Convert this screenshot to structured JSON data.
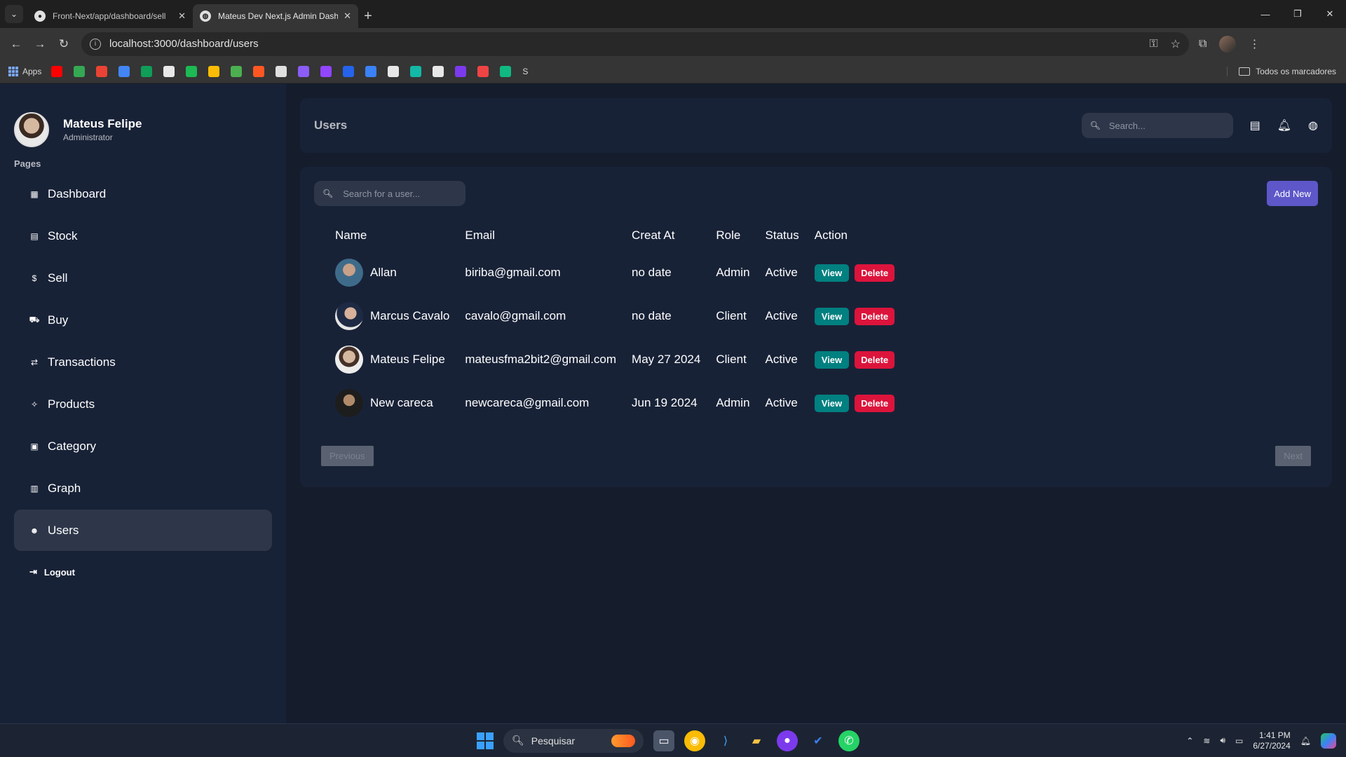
{
  "browser": {
    "tabs": [
      {
        "title": "Front-Next/app/dashboard/sell",
        "active": false,
        "icon": "github-icon"
      },
      {
        "title": "Mateus Dev Next.js Admin Dashboard",
        "active": true,
        "icon": "globe-icon"
      }
    ],
    "url": "localhost:3000/dashboard/users",
    "bookmarks_apps_label": "Apps",
    "bookmarks_s_label": "S",
    "all_bookmarks_label": "Todos os marcadores",
    "bookmark_colors": [
      "#ff0000",
      "#34a853",
      "#ea4335",
      "#4285f4",
      "#0f9d58",
      "#e8e8e8",
      "#1db954",
      "#fbbc05",
      "#4caf50",
      "#ff5722",
      "#e0e0e0",
      "#8b5cf6",
      "#9146ff",
      "#2563eb",
      "#3b82f6",
      "#e8e8e8",
      "#14b8a6",
      "#e8e8e8",
      "#7c3aed",
      "#ef4444",
      "#10b981"
    ]
  },
  "sidebar": {
    "user_name": "Mateus Felipe",
    "user_role": "Administrator",
    "section_title": "Pages",
    "items": [
      {
        "label": "Dashboard",
        "icon": "dashboard-icon",
        "glyph": "▦",
        "active": false
      },
      {
        "label": "Stock",
        "icon": "stock-icon",
        "glyph": "▤",
        "active": false
      },
      {
        "label": "Sell",
        "icon": "dollar-icon",
        "glyph": "$",
        "active": false
      },
      {
        "label": "Buy",
        "icon": "cart-icon",
        "glyph": "⛟",
        "active": false
      },
      {
        "label": "Transactions",
        "icon": "transactions-icon",
        "glyph": "⇄",
        "active": false
      },
      {
        "label": "Products",
        "icon": "products-icon",
        "glyph": "✧",
        "active": false
      },
      {
        "label": "Category",
        "icon": "category-icon",
        "glyph": "▣",
        "active": false
      },
      {
        "label": "Graph",
        "icon": "graph-icon",
        "glyph": "▥",
        "active": false
      },
      {
        "label": "Users",
        "icon": "users-icon",
        "glyph": "☻",
        "active": true
      }
    ],
    "logout_label": "Logout"
  },
  "topbar": {
    "title": "Users",
    "search_placeholder": "Search..."
  },
  "users_panel": {
    "search_placeholder": "Search for a user...",
    "add_new_label": "Add New",
    "columns": [
      "Name",
      "Email",
      "Creat At",
      "Role",
      "Status",
      "Action"
    ],
    "rows": [
      {
        "name": "Allan",
        "email": "biriba@gmail.com",
        "created": "no date",
        "role": "Admin",
        "status": "Active"
      },
      {
        "name": "Marcus Cavalo",
        "email": "cavalo@gmail.com",
        "created": "no date",
        "role": "Client",
        "status": "Active"
      },
      {
        "name": "Mateus Felipe",
        "email": "mateusfma2bit2@gmail.com",
        "created": "May 27 2024",
        "role": "Client",
        "status": "Active"
      },
      {
        "name": "New careca",
        "email": "newcareca@gmail.com",
        "created": "Jun 19 2024",
        "role": "Admin",
        "status": "Active"
      }
    ],
    "view_label": "View",
    "delete_label": "Delete",
    "previous_label": "Previous",
    "next_label": "Next"
  },
  "taskbar": {
    "search_label": "Pesquisar",
    "time": "1:41 PM",
    "date": "6/27/2024"
  },
  "colors": {
    "sidebar_bg": "#182237",
    "page_bg": "#151c2c",
    "active_item": "#2e374a",
    "add_button": "#5d57c9",
    "view_button": "#008080",
    "delete_button": "#dc143c"
  }
}
